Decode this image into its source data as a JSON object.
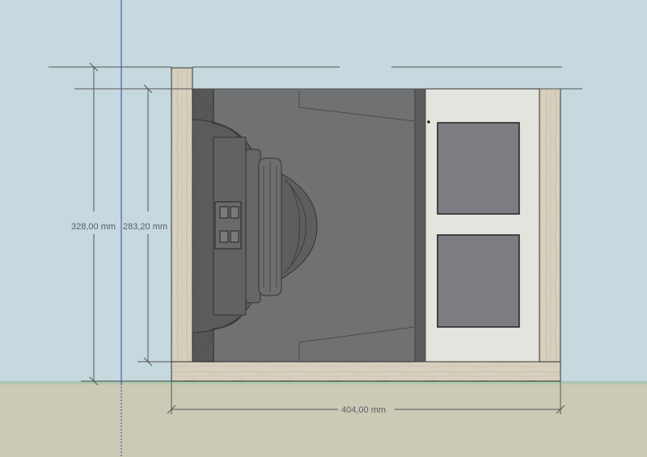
{
  "scene": {
    "sky_color": "#c5d9de",
    "ground_color": "#ccc9b5",
    "horizon_color": "#9dc08b",
    "axis_color": "#3a3acc",
    "wood_color": "#d6cfbe",
    "panel_color": "#e4e4de",
    "glass_color": "#6e6e6e",
    "port_color": "#7b7d82"
  },
  "dimensions": {
    "total_height": "328,00 mm",
    "inner_height": "283,20 mm",
    "width": "404,00 mm"
  },
  "objects": {
    "enclosure": "speaker-enclosure",
    "driver": "subwoofer-driver",
    "ports": [
      "port-upper",
      "port-lower"
    ]
  }
}
